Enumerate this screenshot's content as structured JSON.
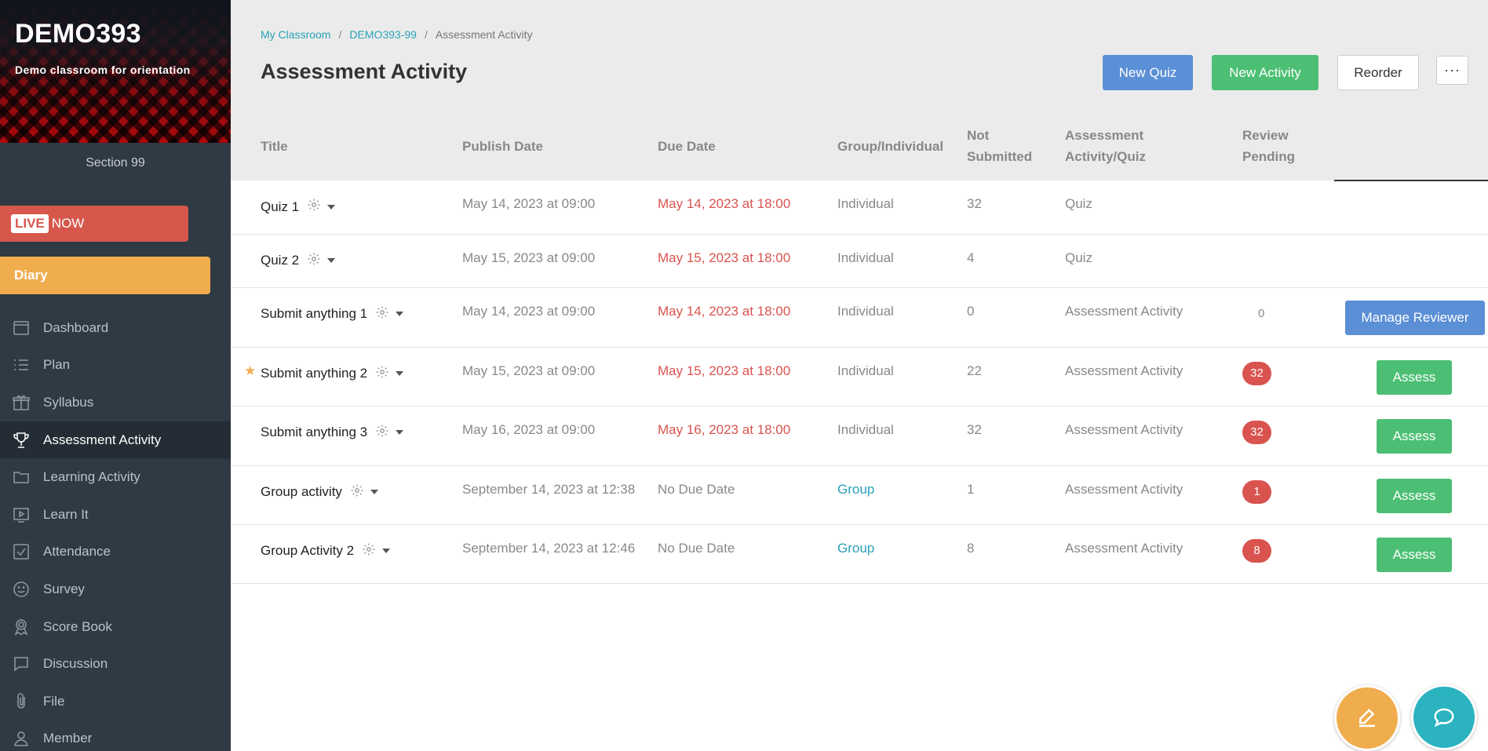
{
  "sidebar": {
    "class_code": "DEMO393",
    "class_desc": "Demo classroom for orientation",
    "section": "Section 99",
    "live_tag": "LIVE",
    "live_now": "NOW",
    "diary": "Diary",
    "items": [
      {
        "label": "Dashboard",
        "icon": "dashboard-icon"
      },
      {
        "label": "Plan",
        "icon": "plan-icon"
      },
      {
        "label": "Syllabus",
        "icon": "syllabus-icon"
      },
      {
        "label": "Assessment Activity",
        "icon": "trophy-icon"
      },
      {
        "label": "Learning Activity",
        "icon": "folder-icon"
      },
      {
        "label": "Learn It",
        "icon": "play-icon"
      },
      {
        "label": "Attendance",
        "icon": "check-icon"
      },
      {
        "label": "Survey",
        "icon": "smile-icon"
      },
      {
        "label": "Score Book",
        "icon": "award-icon"
      },
      {
        "label": "Discussion",
        "icon": "chat-bubble-icon"
      },
      {
        "label": "File",
        "icon": "paperclip-icon"
      },
      {
        "label": "Member",
        "icon": "person-icon"
      }
    ]
  },
  "breadcrumb": {
    "home": "My Classroom",
    "course": "DEMO393-99",
    "current": "Assessment Activity",
    "sep": "/"
  },
  "header": {
    "title": "Assessment Activity",
    "new_quiz": "New Quiz",
    "new_activity": "New Activity",
    "reorder": "Reorder",
    "more": "···"
  },
  "table": {
    "columns": {
      "title": "Title",
      "publish": "Publish Date",
      "due": "Due Date",
      "group": "Group/Individual",
      "not_submitted_1": "Not",
      "not_submitted_2": "Submitted",
      "type_1": "Assessment",
      "type_2": "Activity/Quiz",
      "review_1": "Review",
      "review_2": "Pending"
    },
    "rows": [
      {
        "title": "Quiz 1",
        "publish": "May 14, 2023 at 09:00",
        "due": "May 14, 2023 at 18:00",
        "group": "Individual",
        "not_submitted": "32",
        "type": "Quiz"
      },
      {
        "title": "Quiz 2",
        "publish": "May 15, 2023 at 09:00",
        "due": "May 15, 2023 at 18:00",
        "group": "Individual",
        "not_submitted": "4",
        "type": "Quiz"
      },
      {
        "title": "Submit anything 1",
        "publish": "May 14, 2023 at 09:00",
        "due": "May 14, 2023 at 18:00",
        "group": "Individual",
        "not_submitted": "0",
        "type": "Assessment Activity",
        "review": "0",
        "action": "Manage Reviewer"
      },
      {
        "title": "Submit anything 2",
        "publish": "May 15, 2023 at 09:00",
        "due": "May 15, 2023 at 18:00",
        "group": "Individual",
        "not_submitted": "22",
        "type": "Assessment Activity",
        "review": "32",
        "action": "Assess"
      },
      {
        "title": "Submit anything 3",
        "publish": "May 16, 2023 at 09:00",
        "due": "May 16, 2023 at 18:00",
        "group": "Individual",
        "not_submitted": "32",
        "type": "Assessment Activity",
        "review": "32",
        "action": "Assess"
      },
      {
        "title": "Group activity",
        "publish": "September 14, 2023 at 12:38",
        "due": "No Due Date",
        "group": "Group",
        "not_submitted": "1",
        "type": "Assessment Activity",
        "review": "1",
        "action": "Assess"
      },
      {
        "title": "Group Activity 2",
        "publish": "September 14, 2023 at 12:46",
        "due": "No Due Date",
        "group": "Group",
        "not_submitted": "8",
        "type": "Assessment Activity",
        "review": "8",
        "action": "Assess"
      }
    ]
  },
  "colors": {
    "accent_blue": "#5b8fd6",
    "accent_green": "#4cbf74",
    "due_red": "#d9534f",
    "link_teal": "#2aa1b8",
    "sidebar_bg": "#2f3a44",
    "diary_orange": "#f0ad4e"
  }
}
